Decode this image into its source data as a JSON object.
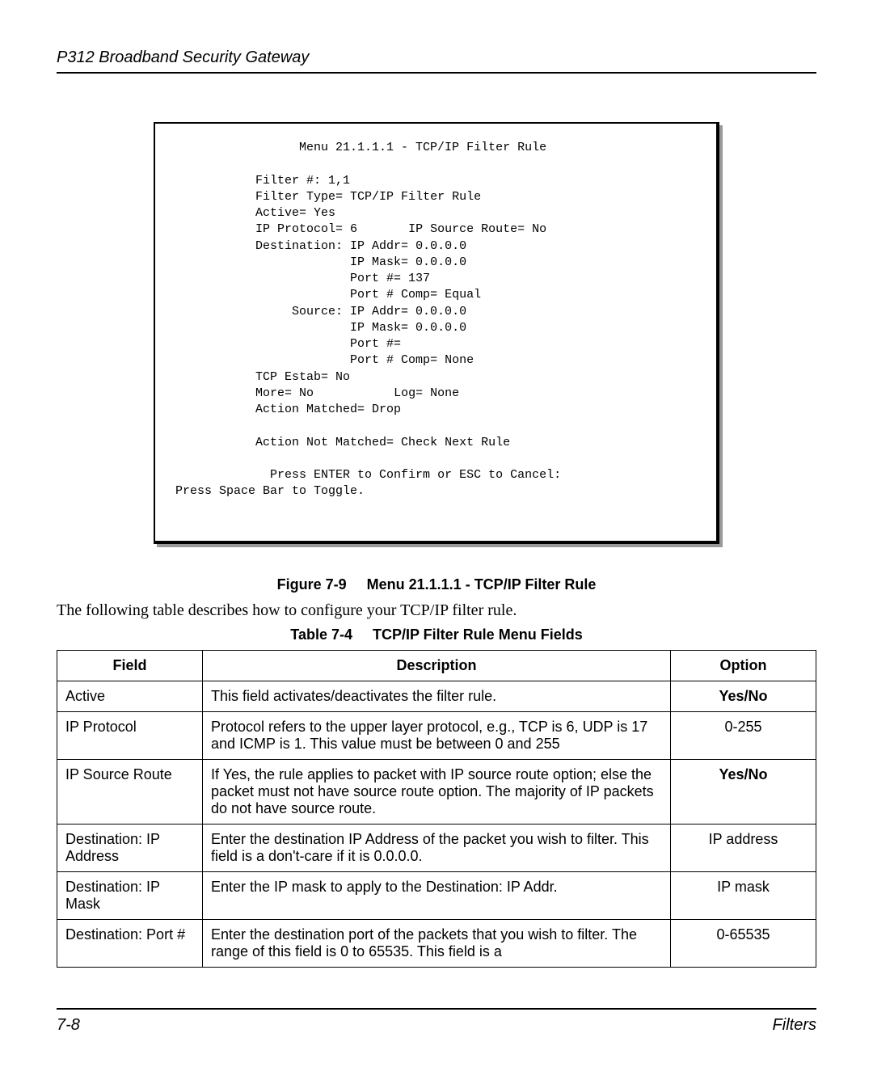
{
  "header": "P312  Broadband Security Gateway",
  "terminal": {
    "title": "Menu 21.1.1.1 - TCP/IP Filter Rule",
    "filter_num": "Filter #: 1,1",
    "filter_type": "Filter Type= TCP/IP Filter Rule",
    "active": "Active= Yes",
    "ip_protocol": "IP Protocol= 6",
    "ip_source_route": "IP Source Route= No",
    "dest_ip": "Destination: IP Addr= 0.0.0.0",
    "dest_mask": "IP Mask= 0.0.0.0",
    "dest_port": "Port #= 137",
    "dest_port_comp": "Port # Comp= Equal",
    "src_ip": "Source: IP Addr= 0.0.0.0",
    "src_mask": "IP Mask= 0.0.0.0",
    "src_port": "Port #=",
    "src_port_comp": "Port # Comp= None",
    "tcp_estab": "TCP Estab= No",
    "more": "More= No",
    "log": "Log= None",
    "action_matched": "Action Matched= Drop",
    "action_not_matched": "Action Not Matched= Check Next Rule",
    "confirm": "Press ENTER to Confirm or ESC to Cancel:",
    "toggle": "Press Space Bar to Toggle."
  },
  "figure_label": "Figure 7-9",
  "figure_title": "Menu 21.1.1.1 - TCP/IP Filter Rule",
  "body_text": "The following table describes how to configure your TCP/IP filter rule.",
  "table_label": "Table 7-4",
  "table_title": "TCP/IP Filter Rule Menu Fields",
  "table": {
    "headers": {
      "field": "Field",
      "description": "Description",
      "option": "Option"
    },
    "rows": [
      {
        "field": "Active",
        "description": "This field activates/deactivates the filter rule.",
        "option": "Yes/No",
        "bold": true
      },
      {
        "field": "IP Protocol",
        "description": "Protocol refers to the upper layer protocol, e.g., TCP is 6, UDP is 17 and ICMP is 1.  This value must be between 0 and 255",
        "option": "0-255",
        "bold": false
      },
      {
        "field": "IP Source Route",
        "description": "If Yes, the rule applies to packet with IP source route option; else the packet must not have source route option. The majority of IP packets do not have source route.",
        "option": "Yes/No",
        "bold": true
      },
      {
        "field": "Destination: IP Address",
        "description": "Enter the destination IP Address of the packet you wish to filter.  This field is a don't-care if it is 0.0.0.0.",
        "option": "IP address",
        "bold": false
      },
      {
        "field": "Destination: IP Mask",
        "description": "Enter the IP mask to apply to the Destination: IP Addr.",
        "option": "IP mask",
        "bold": false
      },
      {
        "field": "Destination: Port #",
        "description": "Enter the destination port of the packets that you wish to filter. The range of this field is 0 to 65535.  This field is a",
        "option": "0-65535",
        "bold": false
      }
    ]
  },
  "footer": {
    "page": "7-8",
    "section": "Filters"
  }
}
